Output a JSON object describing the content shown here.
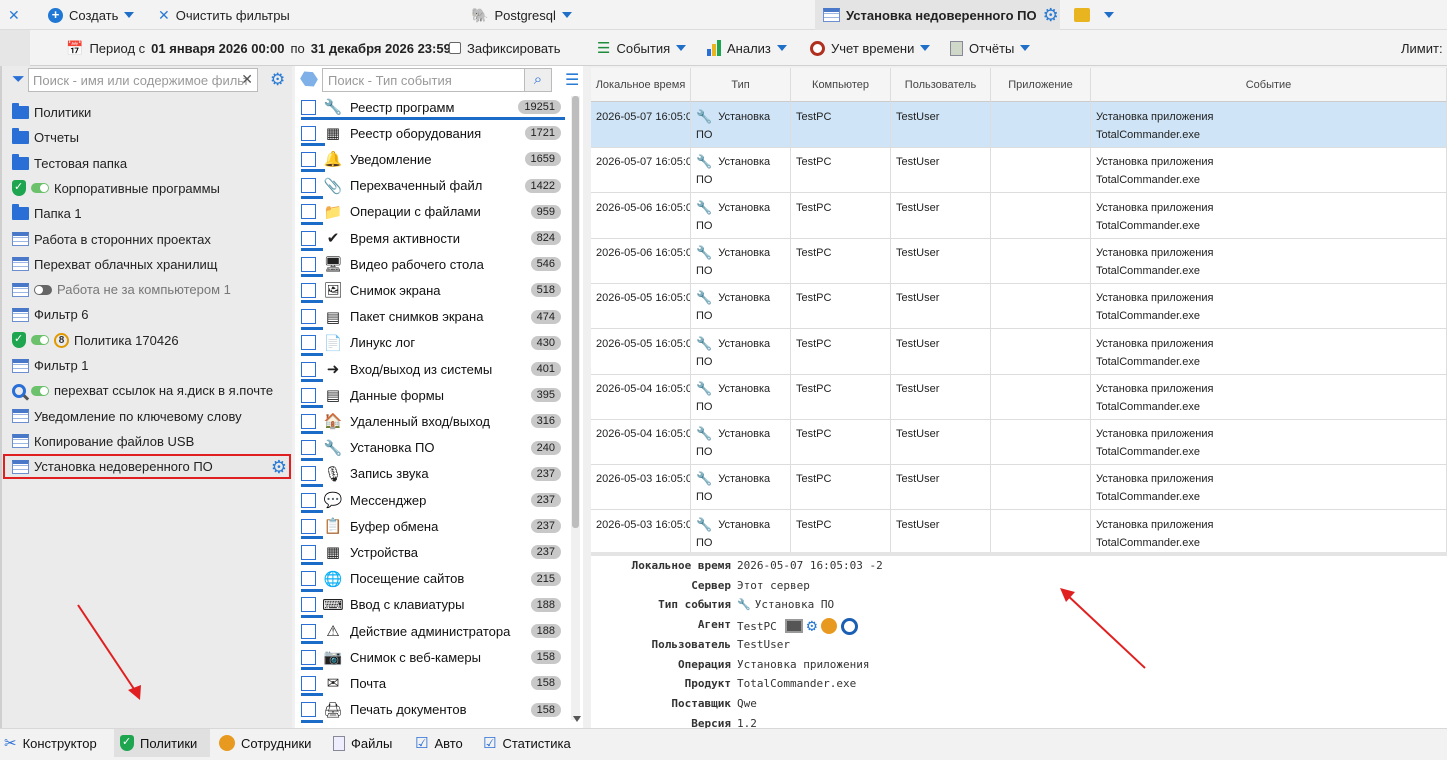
{
  "topbar": {
    "create_label": "Создать",
    "clear_filters_label": "Очистить фильтры",
    "db_label": "Postgresql",
    "active_tab_label": "Установка недоверенного ПО"
  },
  "periodbar": {
    "period_prefix": "Период с",
    "period_from": "01 января 2026 00:00",
    "period_mid": "по",
    "period_to": "31 декабря 2026 23:59",
    "fixed_label": "Зафиксировать",
    "events_label": "События",
    "analysis_label": "Анализ",
    "time_label": "Учет времени",
    "reports_label": "Отчёты",
    "limit_label": "Лимит:"
  },
  "left": {
    "search_placeholder": "Поиск - имя или содержимое фильт",
    "items": [
      {
        "label": "Политики",
        "icon": "folder"
      },
      {
        "label": "Отчеты",
        "icon": "folder"
      },
      {
        "label": "Тестовая папка",
        "icon": "folder"
      },
      {
        "label": "Корпоративные программы",
        "icon": "shield-toggle"
      },
      {
        "label": "Папка 1",
        "icon": "folder"
      },
      {
        "label": "Работа в сторонних проектах",
        "icon": "table"
      },
      {
        "label": "Перехват облачных хранилищ",
        "icon": "table"
      },
      {
        "label": "Работа не за компьютером 1",
        "icon": "table-toggle-off"
      },
      {
        "label": "Фильтр 6",
        "icon": "table"
      },
      {
        "label": "Политика 170426",
        "icon": "shield-toggle-badge",
        "badge": "8"
      },
      {
        "label": "Фильтр 1",
        "icon": "table"
      },
      {
        "label": "перехват ссылок на я.диск в я.почте",
        "icon": "magnifier-toggle"
      },
      {
        "label": "Уведомление по ключевому слову",
        "icon": "table"
      },
      {
        "label": "Копирование файлов USB",
        "icon": "table"
      },
      {
        "label": "Установка недоверенного ПО",
        "icon": "table-selected"
      }
    ]
  },
  "middle": {
    "search_placeholder": "Поиск - Тип события",
    "items": [
      {
        "label": "Реестр программ",
        "count": "19251",
        "bar": 1.0
      },
      {
        "label": "Реестр оборудования",
        "count": "1721",
        "bar": 0.09
      },
      {
        "label": "Уведомление",
        "count": "1659",
        "bar": 0.09
      },
      {
        "label": "Перехваченный файл",
        "count": "1422",
        "bar": 0.07
      },
      {
        "label": "Операции с файлами",
        "count": "959",
        "bar": 0.05
      },
      {
        "label": "Время активности",
        "count": "824",
        "bar": 0.04
      },
      {
        "label": "Видео рабочего стола",
        "count": "546",
        "bar": 0.03
      },
      {
        "label": "Снимок экрана",
        "count": "518",
        "bar": 0.03
      },
      {
        "label": "Пакет снимков экрана",
        "count": "474",
        "bar": 0.02
      },
      {
        "label": "Линукс лог",
        "count": "430",
        "bar": 0.02
      },
      {
        "label": "Вход/выход из системы",
        "count": "401",
        "bar": 0.02
      },
      {
        "label": "Данные формы",
        "count": "395",
        "bar": 0.02
      },
      {
        "label": "Удаленный вход/выход",
        "count": "316",
        "bar": 0.02
      },
      {
        "label": "Установка ПО",
        "count": "240",
        "bar": 0.01
      },
      {
        "label": "Запись звука",
        "count": "237",
        "bar": 0.01
      },
      {
        "label": "Мессенджер",
        "count": "237",
        "bar": 0.01
      },
      {
        "label": "Буфер обмена",
        "count": "237",
        "bar": 0.01
      },
      {
        "label": "Устройства",
        "count": "237",
        "bar": 0.01
      },
      {
        "label": "Посещение сайтов",
        "count": "215",
        "bar": 0.01
      },
      {
        "label": "Ввод с клавиатуры",
        "count": "188",
        "bar": 0.01
      },
      {
        "label": "Действие администратора",
        "count": "188",
        "bar": 0.01
      },
      {
        "label": "Снимок с веб-камеры",
        "count": "158",
        "bar": 0.01
      },
      {
        "label": "Почта",
        "count": "158",
        "bar": 0.01
      },
      {
        "label": "Печать документов",
        "count": "158",
        "bar": 0.01
      }
    ]
  },
  "grid": {
    "headers": [
      "Локальное время",
      "Тип",
      "Компьютер",
      "Пользователь",
      "Приложение",
      "Событие"
    ],
    "rows": [
      {
        "time": "2026-05-07 16:05:0",
        "type1": "Установка",
        "type2": "ПО",
        "pc": "TestPC",
        "user": "TestUser",
        "app": "",
        "ev1": "Установка приложения",
        "ev2": "TotalCommander.exe"
      },
      {
        "time": "2026-05-07 16:05:0",
        "type1": "Установка",
        "type2": "ПО",
        "pc": "TestPC",
        "user": "TestUser",
        "app": "",
        "ev1": "Установка приложения",
        "ev2": "TotalCommander.exe"
      },
      {
        "time": "2026-05-06 16:05:0",
        "type1": "Установка",
        "type2": "ПО",
        "pc": "TestPC",
        "user": "TestUser",
        "app": "",
        "ev1": "Установка приложения",
        "ev2": "TotalCommander.exe"
      },
      {
        "time": "2026-05-06 16:05:0",
        "type1": "Установка",
        "type2": "ПО",
        "pc": "TestPC",
        "user": "TestUser",
        "app": "",
        "ev1": "Установка приложения",
        "ev2": "TotalCommander.exe"
      },
      {
        "time": "2026-05-05 16:05:0",
        "type1": "Установка",
        "type2": "ПО",
        "pc": "TestPC",
        "user": "TestUser",
        "app": "",
        "ev1": "Установка приложения",
        "ev2": "TotalCommander.exe"
      },
      {
        "time": "2026-05-05 16:05:0",
        "type1": "Установка",
        "type2": "ПО",
        "pc": "TestPC",
        "user": "TestUser",
        "app": "",
        "ev1": "Установка приложения",
        "ev2": "TotalCommander.exe"
      },
      {
        "time": "2026-05-04 16:05:0",
        "type1": "Установка",
        "type2": "ПО",
        "pc": "TestPC",
        "user": "TestUser",
        "app": "",
        "ev1": "Установка приложения",
        "ev2": "TotalCommander.exe"
      },
      {
        "time": "2026-05-04 16:05:0",
        "type1": "Установка",
        "type2": "ПО",
        "pc": "TestPC",
        "user": "TestUser",
        "app": "",
        "ev1": "Установка приложения",
        "ev2": "TotalCommander.exe"
      },
      {
        "time": "2026-05-03 16:05:0",
        "type1": "Установка",
        "type2": "ПО",
        "pc": "TestPC",
        "user": "TestUser",
        "app": "",
        "ev1": "Установка приложения",
        "ev2": "TotalCommander.exe"
      },
      {
        "time": "2026-05-03 16:05:0",
        "type1": "Установка",
        "type2": "ПО",
        "pc": "TestPC",
        "user": "TestUser",
        "app": "",
        "ev1": "Установка приложения",
        "ev2": "TotalCommander.exe"
      }
    ]
  },
  "details": {
    "rows": [
      {
        "label": "Локальное время",
        "value": "2026-05-07 16:05:03 -2"
      },
      {
        "label": "Сервер",
        "value": "Этот сервер"
      },
      {
        "label": "Тип события",
        "value": "Установка ПО"
      },
      {
        "label": "Агент",
        "value": "TestPC"
      },
      {
        "label": "Пользователь",
        "value": "TestUser"
      },
      {
        "label": "Операция",
        "value": "Установка приложения"
      },
      {
        "label": "Продукт",
        "value": "TotalCommander.exe"
      },
      {
        "label": "Поставщик",
        "value": "Qwe"
      },
      {
        "label": "Версия",
        "value": "1.2"
      }
    ]
  },
  "bottom": {
    "tabs": [
      "Конструктор",
      "Политики",
      "Сотрудники",
      "Файлы",
      "Авто",
      "Статистика"
    ]
  },
  "colors": {
    "accent": "#1f6fc9",
    "selection": "#cfe4f7",
    "highlight": "#e02020"
  }
}
